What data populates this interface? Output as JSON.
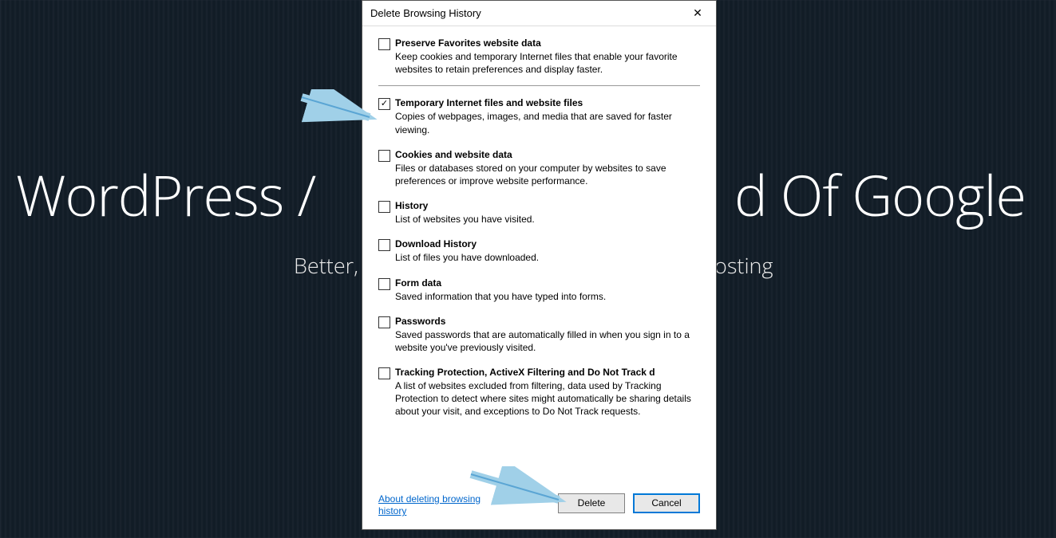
{
  "background": {
    "title_left": "WordPress /",
    "title_right": "d Of Google",
    "sub_left": "Better,",
    "sub_right": "osting"
  },
  "dialog": {
    "title": "Delete Browsing History",
    "close_glyph": "✕",
    "options": [
      {
        "checked": false,
        "divider": true,
        "title": "Preserve Favorites website data",
        "desc": "Keep cookies and temporary Internet files that enable your favorite websites to retain preferences and display faster."
      },
      {
        "checked": true,
        "title": "Temporary Internet files and website files",
        "desc": "Copies of webpages, images, and media that are saved for faster viewing."
      },
      {
        "checked": false,
        "title": "Cookies and website data",
        "desc": "Files or databases stored on your computer by websites to save preferences or improve website performance."
      },
      {
        "checked": false,
        "title": "History",
        "desc": "List of websites you have visited."
      },
      {
        "checked": false,
        "title": "Download History",
        "desc": "List of files you have downloaded."
      },
      {
        "checked": false,
        "title": "Form data",
        "desc": "Saved information that you have typed into forms."
      },
      {
        "checked": false,
        "title": "Passwords",
        "desc": "Saved passwords that are automatically filled in when you sign in to a website you've previously visited."
      },
      {
        "checked": false,
        "title": "Tracking Protection, ActiveX Filtering and Do Not Track d",
        "desc": "A list of websites excluded from filtering, data used by Tracking Protection to detect where sites might automatically be sharing details about your visit, and exceptions to Do Not Track requests."
      }
    ],
    "about_link": "About deleting browsing history",
    "delete_label": "Delete",
    "cancel_label": "Cancel"
  }
}
